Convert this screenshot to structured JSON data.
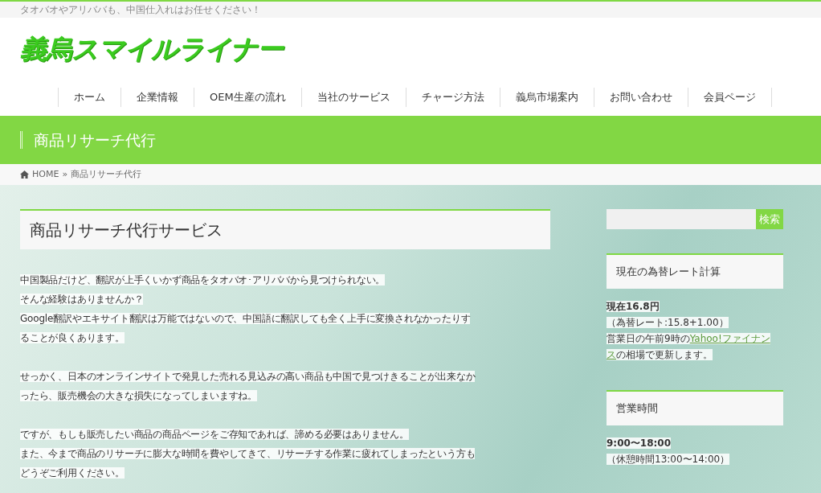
{
  "tagline": "タオバオやアリババも、中国仕入れはお任せください！",
  "logo": "義烏スマイルライナー",
  "nav": [
    {
      "label": "ホーム"
    },
    {
      "label": "企業情報"
    },
    {
      "label": "OEM生産の流れ"
    },
    {
      "label": "当社のサービス"
    },
    {
      "label": "チャージ方法"
    },
    {
      "label": "義烏市場案内"
    },
    {
      "label": "お問い合わせ"
    },
    {
      "label": "会員ページ"
    }
  ],
  "page_title": "商品リサーチ代行",
  "breadcrumb": {
    "home": "HOME",
    "separator": "»",
    "current": "商品リサーチ代行"
  },
  "article": {
    "heading": "商品リサーチ代行サービス",
    "paragraphs": [
      [
        "中国製品だけど、翻訳が上手くいかず商品をタオバオ･アリババから見つけられない。",
        "そんな経験はありませんか？",
        "Google翻訳やエキサイト翻訳は万能ではないので、中国語に翻訳しても全く上手に変換されなかったりす",
        "ることが良くあります。"
      ],
      [
        "せっかく、日本のオンラインサイトで発見した売れる見込みの高い商品も中国で見つけきることが出来なか",
        "ったら、販売機会の大きな損失になってしまいますね。"
      ],
      [
        "ですが、もしも販売したい商品の商品ページをご存知であれば、諦める必要はありません。",
        "また、今まで商品のリサーチに膨大な時間を費やしてきて、リサーチする作業に疲れてしまったという方も",
        "どうぞご利用ください。"
      ]
    ]
  },
  "sidebar": {
    "search_button": "検索",
    "rate": {
      "title": "現在の為替レート計算",
      "value": "現在16.8円",
      "detail": "（為替レート:15.8+1.00）",
      "note_lines": [
        [
          {
            "text": "営業日の午前9時の",
            "link": false
          },
          {
            "text": "Yahoo!ファイナン",
            "link": true
          }
        ],
        [
          {
            "text": "ス",
            "link": true
          },
          {
            "text": "の相場で更新します。",
            "link": false
          }
        ]
      ]
    },
    "hours": {
      "title": "営業時間",
      "value": "9:00〜18:00",
      "detail": "（休憩時間13:00〜14:00）"
    }
  }
}
